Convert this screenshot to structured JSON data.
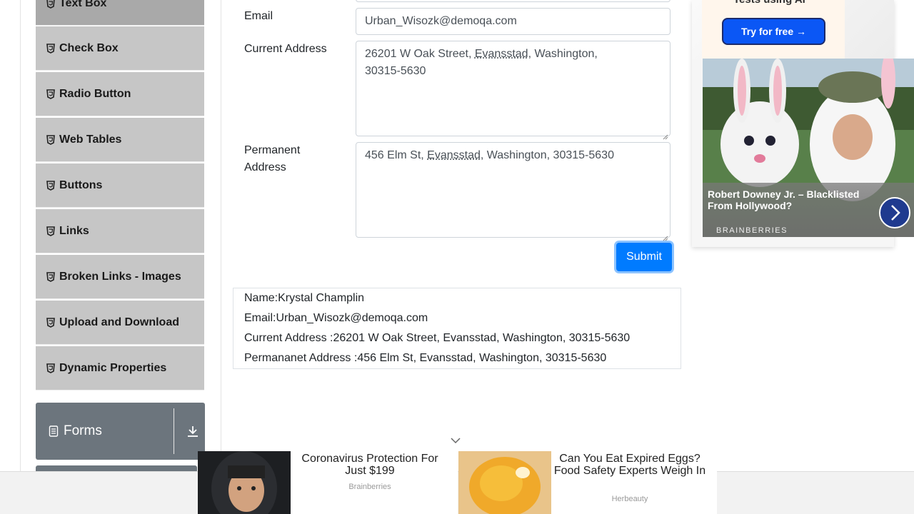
{
  "sidebar": {
    "items": [
      {
        "label": "Text Box"
      },
      {
        "label": "Check Box"
      },
      {
        "label": "Radio Button"
      },
      {
        "label": "Web Tables"
      },
      {
        "label": "Buttons"
      },
      {
        "label": "Links"
      },
      {
        "label": "Broken Links - Images"
      },
      {
        "label": "Upload and Download"
      },
      {
        "label": "Dynamic Properties"
      }
    ],
    "group_forms": {
      "label": "Forms"
    }
  },
  "form": {
    "email": {
      "label": "Email",
      "value": "Urban_Wisozk@demoqa.com"
    },
    "current_address": {
      "label": "Current Address",
      "line1_pre": "26201 W Oak Street, ",
      "line1_city": "Evansstad",
      "line1_post": ", Washington,",
      "line2": "30315-5630"
    },
    "permanent_address": {
      "label_line1": "Permanent",
      "label_line2": "Address",
      "pre": "456 Elm St, ",
      "city": "Evansstad",
      "post": ", Washington, 30315-5630"
    },
    "submit_label": "Submit"
  },
  "output": {
    "name": "Name:Krystal Champlin",
    "email": "Email:Urban_Wisozk@demoqa.com",
    "current": "Current Address :26201 W Oak Street, Evansstad, Washington, 30315-5630",
    "permanent": "Permananet Address :456 Elm St, Evansstad, Washington, 30315-5630"
  },
  "ad_right": {
    "cut_text": "Tests using AI",
    "button_label": "Try for free →",
    "title": "Robert Downey Jr. – Blacklisted From Hollywood?",
    "brand": "BRAINBERRIES"
  },
  "ad_bottom": [
    {
      "headline": "Coronavirus Protection For Just $199",
      "source": "Brainberries"
    },
    {
      "headline": "Can You Eat Expired Eggs? Food Safety Experts Weigh In",
      "source": "Herbeauty"
    }
  ],
  "colors": {
    "accent": "#007bff",
    "menu_bg": "#c6c6c6",
    "group_bg": "#6c757d"
  }
}
